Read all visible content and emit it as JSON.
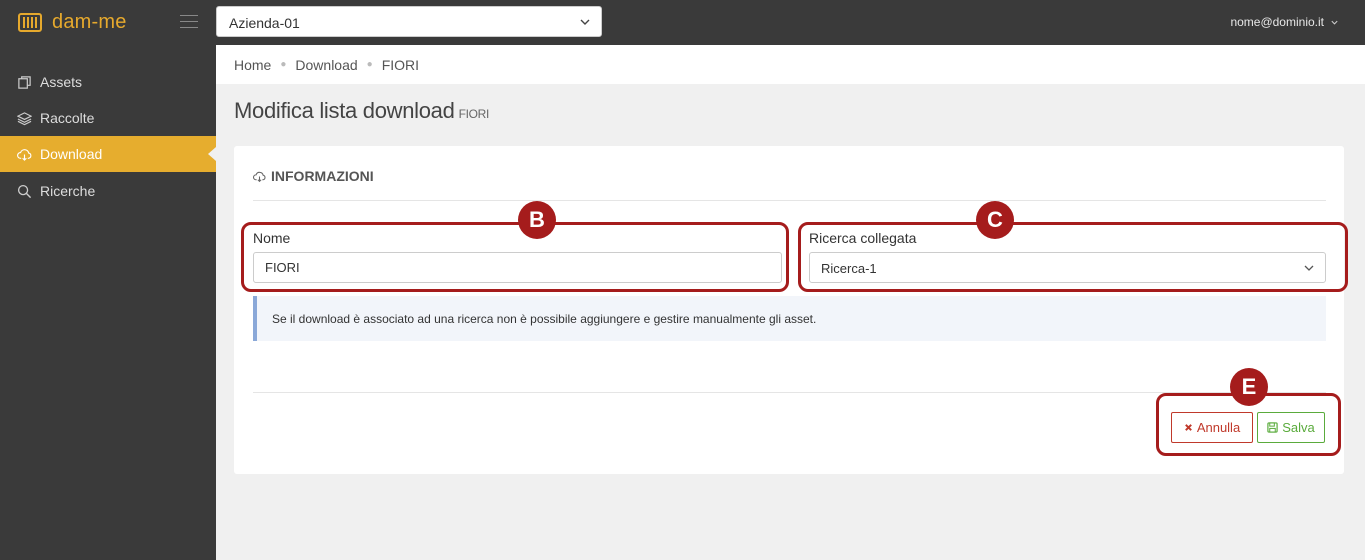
{
  "app": {
    "name": "dam-me",
    "brand_color": "#e6ad2e"
  },
  "topbar": {
    "company": "Azienda-01",
    "user": "nome@dominio.it"
  },
  "sidebar": {
    "items": [
      {
        "label": "Assets",
        "icon": "assets-icon"
      },
      {
        "label": "Raccolte",
        "icon": "layers-icon"
      },
      {
        "label": "Download",
        "icon": "cloud-download-icon",
        "active": true
      },
      {
        "label": "Ricerche",
        "icon": "search-icon"
      }
    ]
  },
  "breadcrumb": [
    "Home",
    "Download",
    "FIORI"
  ],
  "page": {
    "title": "Modifica lista download",
    "subtitle": "FIORI"
  },
  "card": {
    "title": "INFORMAZIONI",
    "name_label": "Nome",
    "name_value": "FIORI",
    "search_label": "Ricerca collegata",
    "search_value": "Ricerca-1",
    "info_text": "Se il download è associato ad una ricerca non è possibile aggiungere e gestire manualmente gli asset.",
    "cancel_label": "Annulla",
    "save_label": "Salva"
  },
  "annotations": {
    "name_field": "B",
    "search_field": "C",
    "buttons": "E",
    "color": "#a51c1c"
  }
}
